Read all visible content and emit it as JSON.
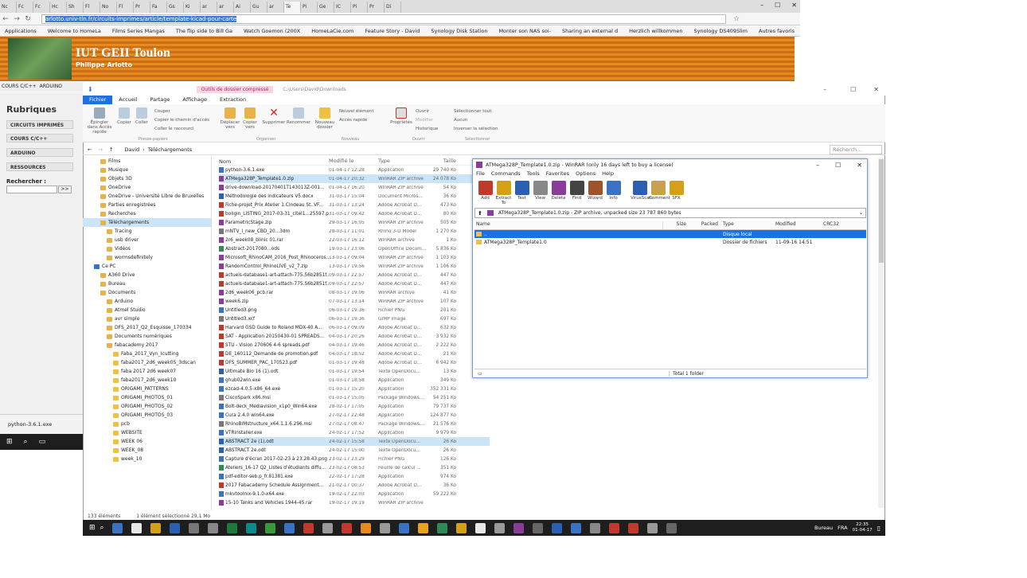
{
  "browser": {
    "tabs": [
      "Nc",
      "Fc",
      "Fc",
      "Hc",
      "Sh",
      "Fl",
      "No",
      "Fl",
      "Pr",
      "Fa",
      "Gs",
      "Ki",
      "ar",
      "ar",
      "Ai",
      "Gu",
      "ar",
      "Te",
      "Pi",
      "Ge",
      "IC",
      "Pi",
      "Pr",
      "Di"
    ],
    "active_tab": 17,
    "url": "arlotto.univ-tln.fr/circuits-imprimes/article/template-kicad-pour-carte",
    "bookmarks": [
      "Applications",
      "Welcome to HomeLa",
      "Films Series Mangas",
      "The flip side to Bill Ga",
      "Watch Goemon (200X",
      "HomeLaCie.com",
      "Feature Story - David",
      "Synology Disk Station",
      "Monter son NAS soi-",
      "Sharing an external d",
      "Herzlich willkommen",
      "Synology DS409Slim",
      "Autres favoris"
    ]
  },
  "site": {
    "title": "IUT GEII Toulon",
    "subtitle": "Philippe Arlotto",
    "nav": [
      "COURS C/C++",
      "ARDUINO"
    ],
    "rubriques": "Rubriques",
    "menu": [
      "CIRCUITS IMPRIMÉS",
      "COURS C/C++",
      "ARDUINO",
      "RESSOURCES"
    ],
    "search_label": "Rechercher :",
    "search_button": ">>",
    "download": "python-3.6.1.exe"
  },
  "explorer": {
    "context_tab": "Outils de dossier compressé",
    "path_title": "C:\\Users\\David\\Downloads",
    "ribbon_tabs": [
      "Fichier",
      "Accueil",
      "Partage",
      "Affichage",
      "Extraction"
    ],
    "ribbon": {
      "pin": "Épingler dans Accès rapide",
      "copy": "Copier",
      "paste": "Coller",
      "cut": "Couper",
      "copy_path": "Copier le chemin d'accès",
      "paste_shortcut": "Coller le raccourci",
      "move": "Déplacer vers",
      "copy_to": "Copier vers",
      "delete": "Supprimer",
      "rename": "Renommer",
      "new_folder": "Nouveau dossier",
      "new_item": "Nouvel élément",
      "easy_access": "Accès rapide",
      "properties": "Propriétés",
      "open": "Ouvrir",
      "modify": "Modifier",
      "history": "Historique",
      "select_all": "Sélectionner tout",
      "select_none": "Aucun",
      "invert": "Inverser la sélection",
      "groups": [
        "Presse-papiers",
        "Organiser",
        "Nouveau",
        "Ouvrir",
        "Sélectionner"
      ]
    },
    "breadcrumb": [
      "David",
      "Téléchargements"
    ],
    "search_placeholder": "Recherch...",
    "nav_items": [
      {
        "label": "Films",
        "indent": 1
      },
      {
        "label": "Musique",
        "indent": 1
      },
      {
        "label": "Objets 3D",
        "indent": 1
      },
      {
        "label": "OneDrive",
        "indent": 1
      },
      {
        "label": "OneDrive - Université Libre de Bruxelles",
        "indent": 1
      },
      {
        "label": "Parties enregistrées",
        "indent": 1
      },
      {
        "label": "Recherches",
        "indent": 1
      },
      {
        "label": "Téléchargements",
        "indent": 1,
        "selected": true
      },
      {
        "label": "Tracing",
        "indent": 2
      },
      {
        "label": "usb driver",
        "indent": 2
      },
      {
        "label": "Vidéos",
        "indent": 2
      },
      {
        "label": "wormsdefinitely",
        "indent": 2
      },
      {
        "label": "Ce PC",
        "indent": 0
      },
      {
        "label": "A360 Drive",
        "indent": 1
      },
      {
        "label": "Bureau",
        "indent": 1
      },
      {
        "label": "Documents",
        "indent": 1
      },
      {
        "label": "Arduino",
        "indent": 2
      },
      {
        "label": "Atmel Studio",
        "indent": 2
      },
      {
        "label": "avr simple",
        "indent": 2
      },
      {
        "label": "DFS_2017_Q2_Esquisse_170334",
        "indent": 2
      },
      {
        "label": "Documents numériques",
        "indent": 2
      },
      {
        "label": "fabacademy 2017",
        "indent": 2
      },
      {
        "label": "Faba_2017_Vyn_Icutting",
        "indent": 3
      },
      {
        "label": "faba2017_2d6_week05_3dscan",
        "indent": 3
      },
      {
        "label": "faba 2017 2d6 week07",
        "indent": 3
      },
      {
        "label": "faba2017_2d6_week10",
        "indent": 3
      },
      {
        "label": "ORIGAMI_PATTERNS",
        "indent": 3
      },
      {
        "label": "ORIGAMI_PHOTOS_01",
        "indent": 3
      },
      {
        "label": "ORIGAMI_PHOTOS_02",
        "indent": 3
      },
      {
        "label": "ORIGAMI_PHOTOS_03",
        "indent": 3
      },
      {
        "label": "pcb",
        "indent": 3
      },
      {
        "label": "WEBSITE",
        "indent": 3
      },
      {
        "label": "WEEK 06",
        "indent": 3
      },
      {
        "label": "WEEK_08",
        "indent": 3
      },
      {
        "label": "week_10",
        "indent": 3
      }
    ],
    "columns": [
      "Nom",
      "Modifié le",
      "Type",
      "Taille"
    ],
    "files": [
      {
        "name": "python-3.6.1.exe",
        "date": "01-04-17 12:28",
        "type": "Application",
        "size": "29 740 Ko",
        "c": "#3a72c4"
      },
      {
        "name": "ATMega328P_Template1.0.zip",
        "date": "01-04-17 20:32",
        "type": "WinRAR ZIP archive",
        "size": "24 078 Ko",
        "c": "#8a3c9a",
        "sel": true
      },
      {
        "name": "drive-download-20170401T143013Z-001...",
        "date": "01-04-17 16:20",
        "type": "WinRAR ZIP archive",
        "size": "54 Ko",
        "c": "#8a3c9a"
      },
      {
        "name": "Méthodologie des indicateurs V5.docx",
        "date": "31-03-17 15:04",
        "type": "Document Micros...",
        "size": "36 Ko",
        "c": "#2b5fb3"
      },
      {
        "name": "Fiche-projet_Prix Atelier 1.Cindeau St..VF...",
        "date": "31-03-17 13:24",
        "type": "Adobe Acrobat D...",
        "size": "473 Ko",
        "c": "#c0392b"
      },
      {
        "name": "boligin_LISTING_2017-03-31_citel1...25597.pdf",
        "date": "31-03-17 09:42",
        "type": "Adobe Acrobat D...",
        "size": "80 Ko",
        "c": "#c0392b"
      },
      {
        "name": "ParametricStage.zip",
        "date": "29-03-17 16:05",
        "type": "WinRAR ZIP archive",
        "size": "505 Ko",
        "c": "#8a3c9a"
      },
      {
        "name": "mNTV_I_new_CBD_20...3dm",
        "date": "28-03-17 11:01",
        "type": "Rhino 3-D Model",
        "size": "1 270 Ko",
        "c": "#777"
      },
      {
        "name": "2r6_week08_blinic 01.rar",
        "date": "22-03-17 16:12",
        "type": "WinRAR archive",
        "size": "1 Ko",
        "c": "#8a3c9a"
      },
      {
        "name": "Abstract-2017080...ods",
        "date": "19-03-17 23:06",
        "type": "OpenOffice Docum...",
        "size": "5 836 Ko",
        "c": "#2e8b57"
      },
      {
        "name": "Microsoft_RhinoCAM_2016_Post_Rhinoceros...",
        "date": "13-03-17 09:04",
        "type": "WinRAR ZIP archive",
        "size": "1 103 Ko",
        "c": "#8a3c9a"
      },
      {
        "name": "RandomControl_RhinoLIVE_v2_7.zip",
        "date": "13-03-17 19:56",
        "type": "WinRAR ZIP archive",
        "size": "1 106 Ko",
        "c": "#8a3c9a"
      },
      {
        "name": "actuels-database1-art-attach-775.56b2851f...",
        "date": "09-03-17 22:57",
        "type": "Adobe Acrobat D...",
        "size": "447 Ko",
        "c": "#c0392b"
      },
      {
        "name": "actuels-database1-art-attach-775.56b2851f...",
        "date": "09-03-17 22:57",
        "type": "Adobe Acrobat D...",
        "size": "447 Ko",
        "c": "#c0392b"
      },
      {
        "name": "2d6_week06_pcb.rar",
        "date": "08-03-17 19:06",
        "type": "WinRAR archive",
        "size": "41 Ko",
        "c": "#8a3c9a"
      },
      {
        "name": "week6.zip",
        "date": "07-03-17 13:14",
        "type": "WinRAR ZIP archive",
        "size": "107 Ko",
        "c": "#8a3c9a"
      },
      {
        "name": "Untitled3.png",
        "date": "06-03-17 19:36",
        "type": "Fichier PNG",
        "size": "201 Ko",
        "c": "#3a72c4"
      },
      {
        "name": "Untitled3.xcf",
        "date": "06-03-17 19:36",
        "type": "GIMP image",
        "size": "697 Ko",
        "c": "#777"
      },
      {
        "name": "Harvard GSD Guide to Roland MDX-40 A...",
        "date": "06-03-17 09:09",
        "type": "Adobe Acrobat D...",
        "size": "632 Ko",
        "c": "#c0392b"
      },
      {
        "name": "SAT - Application 20150430-01 SPREADS...",
        "date": "04-03-17 20:26",
        "type": "Adobe Acrobat D...",
        "size": "3 932 Ko",
        "c": "#c0392b"
      },
      {
        "name": "STU - Vision 270606 4-6 spreads.pdf",
        "date": "04-03-17 19:46",
        "type": "Adobe Acrobat D...",
        "size": "2 222 Ko",
        "c": "#c0392b"
      },
      {
        "name": "DE_160112_Demande de promotion.pdf",
        "date": "04-03-17 18:52",
        "type": "Adobe Acrobat D...",
        "size": "21 Ko",
        "c": "#c0392b"
      },
      {
        "name": "DFS_SUMMER_PAC_170523.pdf",
        "date": "01-03-17 19:48",
        "type": "Adobe Acrobat D...",
        "size": "6 942 Ko",
        "c": "#c0392b"
      },
      {
        "name": "Ultimate Bio 16 (1).odt",
        "date": "01-03-17 19:54",
        "type": "Texte OpenDocu...",
        "size": "13 Ko",
        "c": "#2b5fb3"
      },
      {
        "name": "ghub02win.exe",
        "date": "01-03-17 18:58",
        "type": "Application",
        "size": "349 Ko",
        "c": "#3a72c4"
      },
      {
        "name": "ezcad-4.0.5-x86_64.exe",
        "date": "01-03-17 15:20",
        "type": "Application",
        "size": "352 331 Ko",
        "c": "#3a72c4"
      },
      {
        "name": "CiscoSpark x86.msi",
        "date": "01-03-17 15:05",
        "type": "Package Windows...",
        "size": "54 251 Ko",
        "c": "#777"
      },
      {
        "name": "Bolt-deck_Mediavision_x1p0_Win64.exe",
        "date": "28-02-17 17:05",
        "type": "Application",
        "size": "79 737 Ko",
        "c": "#3a72c4"
      },
      {
        "name": "Cura 2.4.0 win64.exe",
        "date": "27-02-17 22:48",
        "type": "Application",
        "size": "124 877 Ko",
        "c": "#3a72c4"
      },
      {
        "name": "RhinoBIMstructure_x64.1.1.6.296.msi",
        "date": "27-02-17 08:47",
        "type": "Package Windows...",
        "size": "21 576 Ko",
        "c": "#777"
      },
      {
        "name": "VTRinstaller.exe",
        "date": "24-02-17 17:52",
        "type": "Application",
        "size": "9 979 Ko",
        "c": "#3a72c4"
      },
      {
        "name": "ABSTRACT 2e (1).odt",
        "date": "24-02-17 15:58",
        "type": "Texte OpenDocu...",
        "size": "26 Ko",
        "c": "#2b5fb3",
        "sel": true
      },
      {
        "name": "ABSTRACT 2e.odt",
        "date": "24-02-17 15:00",
        "type": "Texte OpenDocu...",
        "size": "26 Ko",
        "c": "#2b5fb3"
      },
      {
        "name": "Capture d'écran 2017-02-23 à 23.28.43.png",
        "date": "23-02-17 23:29",
        "type": "Fichier PNG",
        "size": "126 Ko",
        "c": "#3a72c4"
      },
      {
        "name": "Ateliers_16-17 Q2_Listes d'étudiants diffu...",
        "date": "23-02-17 08:53",
        "type": "Feuille de calcul ...",
        "size": "351 Ko",
        "c": "#2e8b57"
      },
      {
        "name": "pdf-editor-seb.p_fr.81381.exe",
        "date": "22-02-17 17:28",
        "type": "Application",
        "size": "974 Ko",
        "c": "#3a72c4"
      },
      {
        "name": "2017 Fabacademy Schedule Assignment...",
        "date": "21-02-17 00:37",
        "type": "Adobe Acrobat D...",
        "size": "36 Ko",
        "c": "#c0392b"
      },
      {
        "name": "mkvtoolnix-9.1.0-x64.exe",
        "date": "19-02-17 22:03",
        "type": "Application",
        "size": "59 222 Ko",
        "c": "#3a72c4"
      },
      {
        "name": "15-10 Tanks and Vehicles 1944-45.rar",
        "date": "19-02-17 19:19",
        "type": "WinRAR ZIP archive",
        "size": "",
        "c": "#8a3c9a"
      }
    ],
    "status": [
      "133 éléments",
      "1 élément sélectionné 29,1 Mo"
    ]
  },
  "winrar": {
    "title": "ATMega328P_Template1.0.zip - WinRAR (only 16 days left to buy a license)",
    "menu": [
      "File",
      "Commands",
      "Tools",
      "Favorites",
      "Options",
      "Help"
    ],
    "tools": [
      "Add",
      "Extract To",
      "Test",
      "View",
      "Delete",
      "Find",
      "Wizard",
      "Info",
      "VirusScan",
      "Comment",
      "SFX"
    ],
    "tool_colors": [
      "#c0392b",
      "#d4a017",
      "#2b5fb3",
      "#888",
      "#8a3c9a",
      "#444",
      "#a0522d",
      "#3a72c4",
      "#2b5fb3",
      "#c8a24a",
      "#d4a017"
    ],
    "address": "ATMega328P_Template1.0.zip - ZIP archive, unpacked size 23 787 860 bytes",
    "columns": [
      "Name",
      "Size",
      "Packed",
      "Type",
      "Modified",
      "CRC32"
    ],
    "rows": [
      {
        "name": "..",
        "size": "",
        "packed": "",
        "type": "Disque local",
        "modified": "",
        "sel": true
      },
      {
        "name": "ATMega328P_Template1.0",
        "size": "",
        "packed": "",
        "type": "Dossier de fichiers",
        "modified": "11-09-16 14:51"
      }
    ],
    "status": "Total 1 folder"
  },
  "taskbar": {
    "label": "Bureau",
    "lang": "FRA",
    "time": "22:35",
    "date": "01-04-17",
    "icons": [
      "#3a72c4",
      "#e8e8e8",
      "#d4a017",
      "#2b5fb3",
      "#777",
      "#888",
      "#1f7a3a",
      "#0a8a8a",
      "#3a9a3a",
      "#3a72c4",
      "#c0392b",
      "#999",
      "#c0392b",
      "#e6891f",
      "#999",
      "#3a72c4",
      "#e8a020",
      "#2e8b57",
      "#d4a017",
      "#e8e8e8",
      "#999",
      "#8a3c9a",
      "#666",
      "#2b5fb3",
      "#3a72c4",
      "#888",
      "#c0392b",
      "#c0392b",
      "#999",
      "#666"
    ]
  }
}
